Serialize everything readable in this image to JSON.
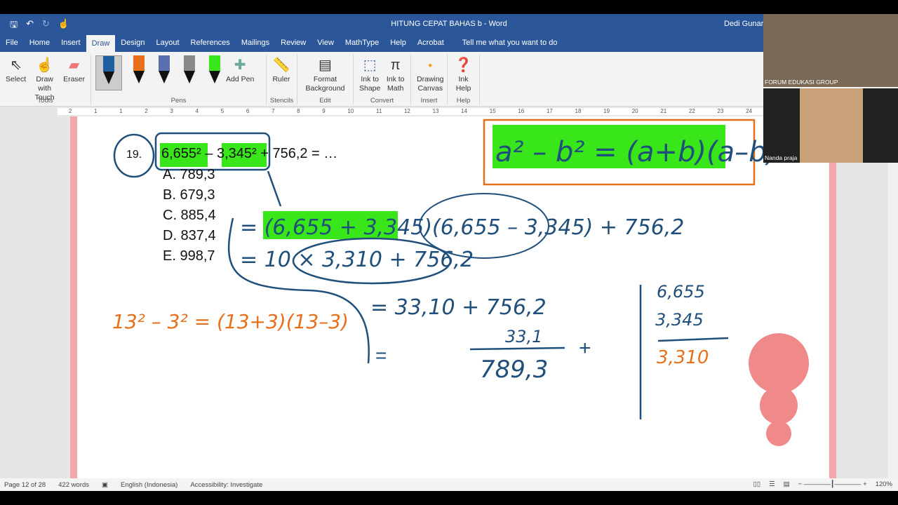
{
  "titlebar": {
    "title": "HITUNG CEPAT BAHAS b  -  Word",
    "user": "Dedi Gunarto"
  },
  "tabs": [
    "File",
    "Home",
    "Insert",
    "Draw",
    "Design",
    "Layout",
    "References",
    "Mailings",
    "Review",
    "View",
    "MathType",
    "Help",
    "Acrobat"
  ],
  "active_tab": "Draw",
  "tell_me": "Tell me what you want to do",
  "ribbon": {
    "tools": {
      "label": "Tools",
      "select": "Select",
      "draw_touch": "Draw with Touch",
      "eraser": "Eraser"
    },
    "pens": {
      "label": "Pens",
      "add_pen": "Add Pen",
      "colors": [
        "#1f5fa0",
        "#e8701a",
        "#5b6fb0",
        "#888888",
        "#39e61a"
      ]
    },
    "stencils": {
      "label": "Stencils",
      "ruler": "Ruler"
    },
    "edit": {
      "label": "Edit",
      "format_background": "Format Background"
    },
    "convert": {
      "label": "Convert",
      "ink_shape": "Ink to Shape",
      "ink_math": "Ink to Math"
    },
    "insert": {
      "label": "Insert",
      "drawing_canvas": "Drawing Canvas"
    },
    "help": {
      "label": "Help",
      "ink_help": "Ink Help"
    }
  },
  "ruler_ticks": [
    "2",
    "1",
    "1",
    "2",
    "3",
    "4",
    "5",
    "6",
    "7",
    "8",
    "9",
    "10",
    "11",
    "12",
    "13",
    "14",
    "15",
    "16",
    "17",
    "18",
    "19",
    "20",
    "21",
    "22",
    "23",
    "24"
  ],
  "document": {
    "number": "19.",
    "question": "6,655² – 3,345² + 756,2 = …",
    "options": [
      "A. 789,3",
      "B. 679,3",
      "C. 885,4",
      "D. 837,4",
      "E. 998,7"
    ],
    "handwriting": {
      "formula": "a² – b² = (a+b)(a–b)",
      "step1": "= (6,655 + 3,345)(6,655 – 3,345) + 756,2",
      "step2": "= 10 × 3,310 + 756,2",
      "step3": "= 33,10 + 756,2",
      "add_top": "33,1",
      "add_result": "789,3",
      "example": "13² – 3² = (13+3)(13–3)",
      "sub_top": "6,655",
      "sub_mid": "3,345",
      "sub_result": "3,310"
    }
  },
  "status": {
    "page": "Page 12 of 28",
    "words": "422 words",
    "language": "English (Indonesia)",
    "accessibility": "Accessibility: Investigate",
    "zoom": "120%"
  },
  "participants": [
    "FORUM EDUKASI GROUP",
    "Nanda praja"
  ]
}
